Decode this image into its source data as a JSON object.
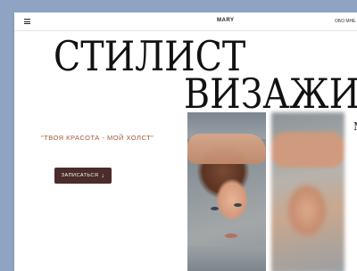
{
  "header": {
    "brand": "MARY",
    "nav_link": "ОБО МНЕ"
  },
  "hero": {
    "line1": "СТИЛИСТ",
    "line2": "ВИЗАЖИ"
  },
  "tagline": "\"ТВОЯ КРАСОТА - МОЙ ХОЛСТ\"",
  "cta": {
    "label": "ЗАПИСАТЬСЯ",
    "arrow": "↓"
  },
  "peek_text": "М",
  "colors": {
    "background": "#8fa3c2",
    "cta": "#4a2c2a",
    "tagline": "#9a5a3a"
  },
  "icons": [
    "hamburger-menu-icon",
    "arrow-down-icon"
  ]
}
